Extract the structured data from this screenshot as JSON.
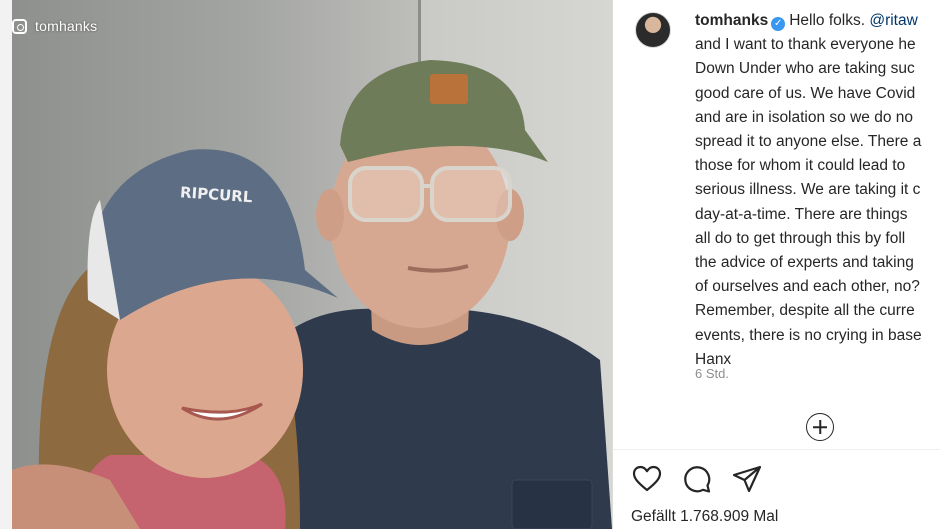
{
  "photo": {
    "watermark_handle": "tomhanks",
    "watermark_icon": "instagram-icon",
    "cap_left_text": "RIPCURL"
  },
  "post": {
    "username": "tomhanks",
    "verified_icon": "verified-badge-icon",
    "caption_lines": [
      "Hello folks. @ritaw",
      "and I want to thank everyone he",
      "Down Under who are taking suc",
      "good care of us. We have Covid",
      "and are in isolation so we do no",
      "spread it to anyone else. There a",
      "those for whom it could lead to",
      "serious illness. We are taking it c",
      "day-at-a-time. There are things",
      "all do to get through this by foll",
      "the advice of experts and taking",
      "of ourselves and each other, no?",
      "Remember, despite all the curre",
      "events, there is no crying in base",
      "Hanx"
    ],
    "caption_first_prefix": "Hello folks. ",
    "mention": "@ritaw",
    "timestamp": "6 Std.",
    "add_comment_icon": "add-circle-icon",
    "action_icons": [
      "heart-icon",
      "comment-icon",
      "share-icon"
    ],
    "likes_text": "Gefällt 1.768.909 Mal",
    "colors": {
      "verified": "#3897f0",
      "mention": "#00376b",
      "muted": "#8e8e8e"
    }
  }
}
